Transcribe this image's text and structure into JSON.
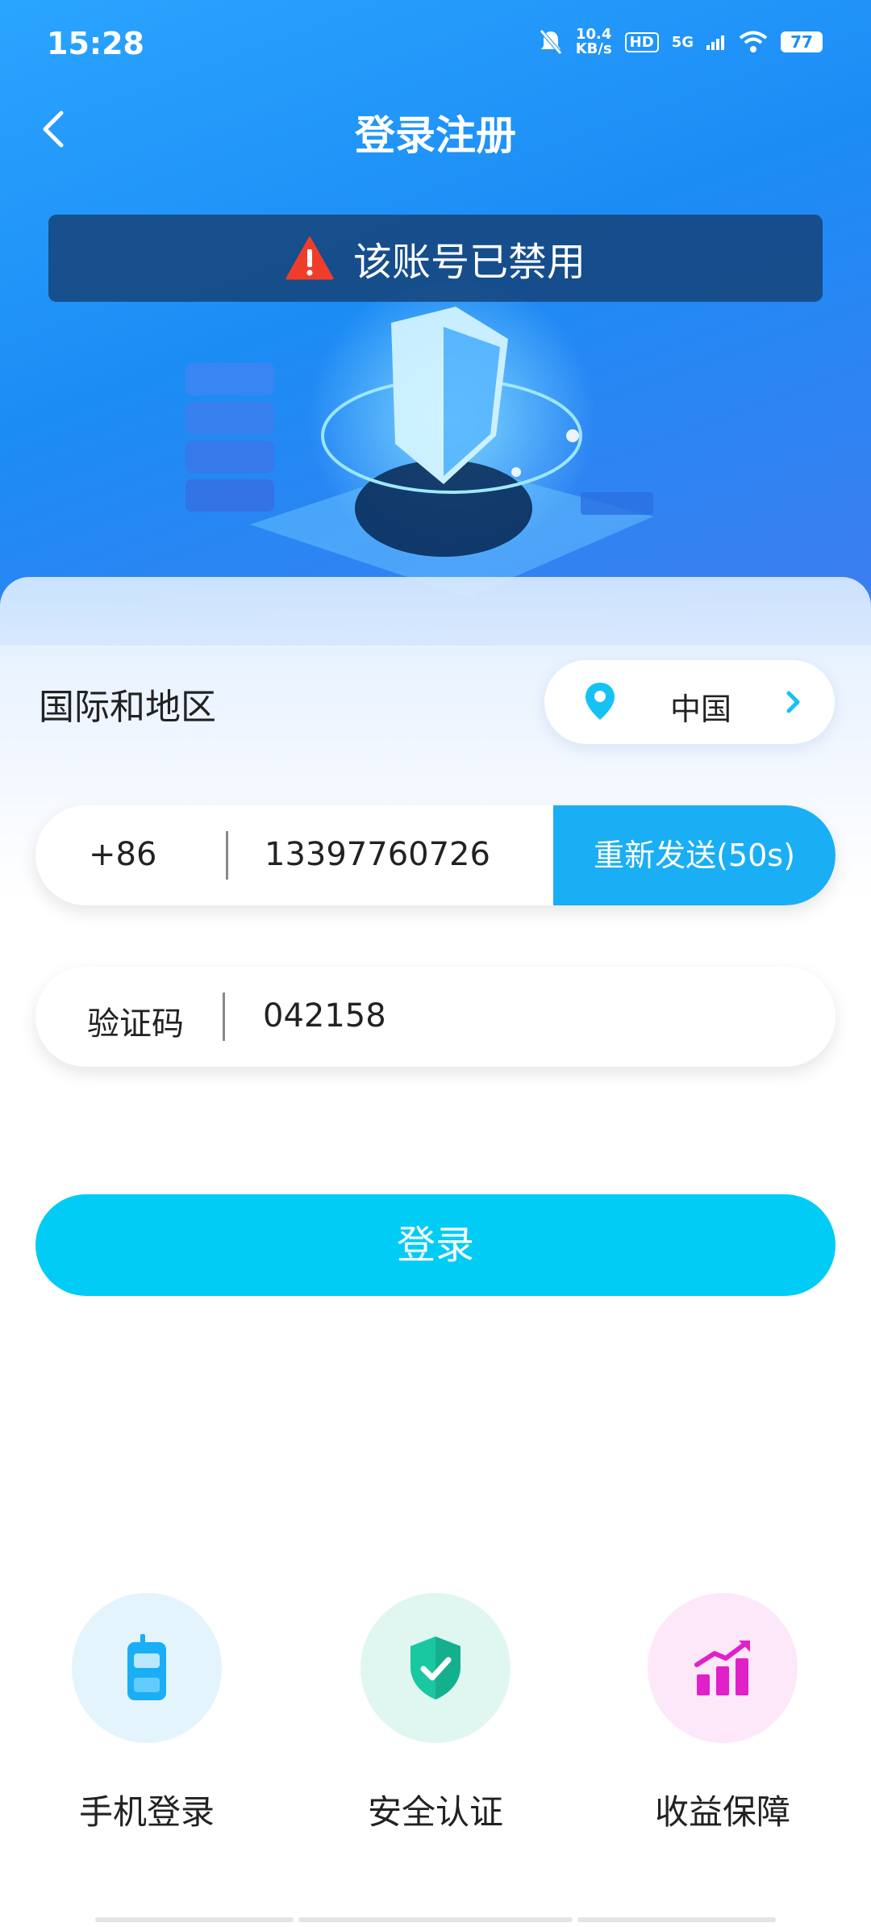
{
  "status": {
    "time": "15:28",
    "net_speed_value": "10.4",
    "net_speed_unit": "KB/s",
    "hd": "HD",
    "signal": "5G",
    "battery": "77"
  },
  "nav": {
    "title": "登录注册",
    "back_icon": "chevron-left-icon"
  },
  "toast": {
    "text": "该账号已禁用",
    "icon": "warning-triangle-icon",
    "icon_color": "#f03d2a"
  },
  "region": {
    "label": "国际和地区",
    "value": "中国",
    "icon": "location-pin-icon",
    "accent": "#16c2f3"
  },
  "phone": {
    "prefix": "+86",
    "number": "13397760726",
    "resend_label": "重新发送(50s)"
  },
  "code": {
    "label": "验证码",
    "value": "042158"
  },
  "login": {
    "label": "登录",
    "color": "#00ccf5"
  },
  "features": [
    {
      "label": "手机登录",
      "icon": "mobile-phone-icon",
      "color": "#1aaef5"
    },
    {
      "label": "安全认证",
      "icon": "shield-check-icon",
      "color": "#19c7a0"
    },
    {
      "label": "收益保障",
      "icon": "growth-chart-icon",
      "color": "#e020c8"
    }
  ]
}
